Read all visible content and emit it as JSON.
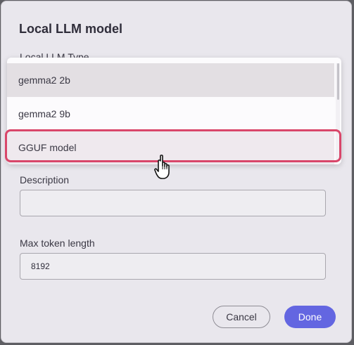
{
  "dialog": {
    "title": "Local LLM model"
  },
  "fields": {
    "type_label": "Local LLM Type",
    "description_label": "Description",
    "description_value": "",
    "max_token_label": "Max token length",
    "max_token_value": "8192"
  },
  "dropdown": {
    "options": [
      {
        "label": "gemma2 2b"
      },
      {
        "label": "gemma2 9b"
      },
      {
        "label": "GGUF model"
      }
    ],
    "highlighted_index": 2
  },
  "buttons": {
    "cancel_label": "Cancel",
    "done_label": "Done"
  },
  "colors": {
    "accent": "#6366e1",
    "highlight_border": "#d9466a"
  },
  "cursor": {
    "icon": "hand-pointer-icon"
  }
}
